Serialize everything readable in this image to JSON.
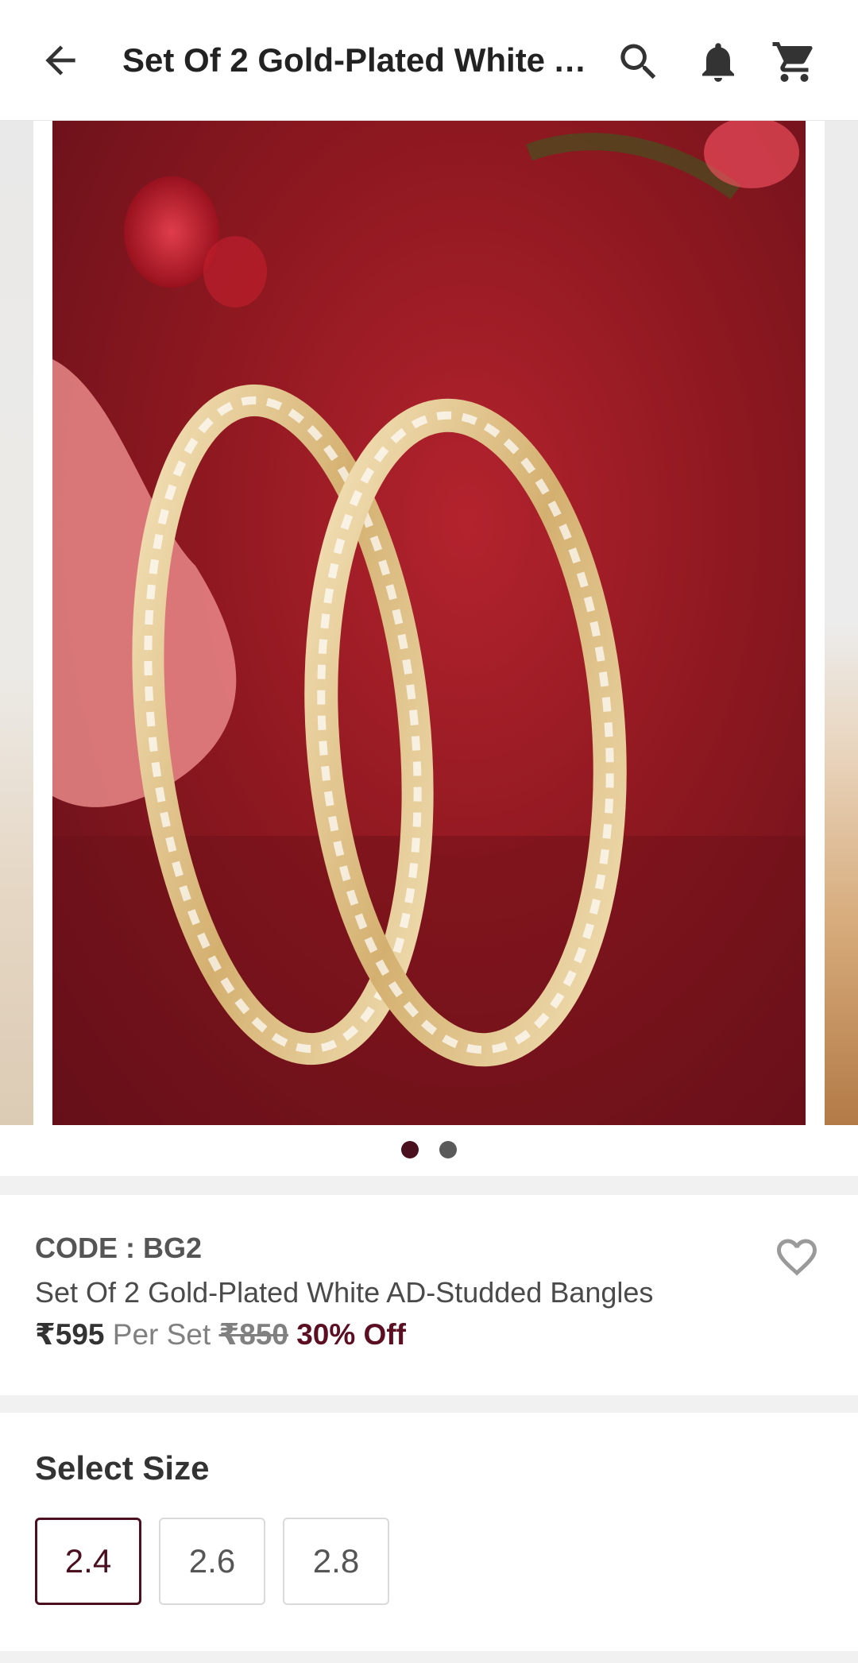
{
  "header": {
    "title": "Set Of 2 Gold-Plated White AD-Studded Bangles",
    "icons": [
      "back-arrow-icon",
      "search-icon",
      "bell-icon",
      "cart-icon"
    ]
  },
  "gallery": {
    "slide_count": 2,
    "active_index": 0
  },
  "product": {
    "code": "CODE : BG2",
    "name": "Set Of 2 Gold-Plated White AD-Studded Bangles",
    "price": "₹595",
    "price_unit": "Per Set",
    "mrp": "₹850",
    "discount": "30% Off"
  },
  "size_selector": {
    "title": "Select Size",
    "options": [
      "2.4",
      "2.6",
      "2.8"
    ],
    "selected": "2.4"
  },
  "colors": {
    "accent": "#4a1020",
    "discount": "#5c0f22"
  }
}
